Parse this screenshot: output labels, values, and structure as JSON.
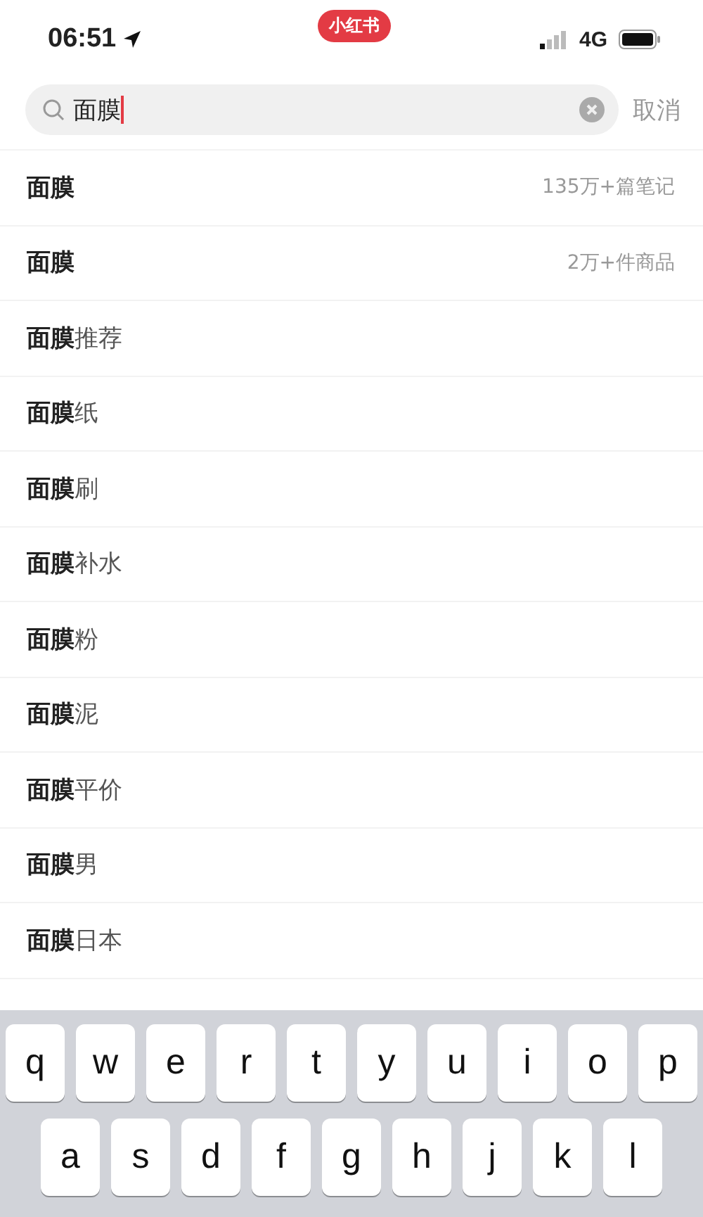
{
  "status_bar": {
    "time": "06:51",
    "app_badge": "小红书",
    "network": "4G"
  },
  "search": {
    "value": "面膜",
    "cancel": "取消"
  },
  "suggestions": [
    {
      "match": "面膜",
      "meta": "135万+篇笔记"
    },
    {
      "match": "面膜",
      "meta": "2万+件商品"
    },
    {
      "match": "面膜",
      "suffix": "推荐"
    },
    {
      "match": "面膜",
      "suffix": "纸"
    },
    {
      "match": "面膜",
      "suffix": "刷"
    },
    {
      "match": "面膜",
      "suffix": "补水"
    },
    {
      "match": "面膜",
      "suffix": "粉"
    },
    {
      "match": "面膜",
      "suffix": "泥"
    },
    {
      "match": "面膜",
      "suffix": "平价"
    },
    {
      "match": "面膜",
      "suffix": "男"
    },
    {
      "match": "面膜",
      "suffix": "日本"
    }
  ],
  "keyboard": {
    "rows": [
      [
        "q",
        "w",
        "e",
        "r",
        "t",
        "y",
        "u",
        "i",
        "o",
        "p"
      ],
      [
        "a",
        "s",
        "d",
        "f",
        "g",
        "h",
        "j",
        "k",
        "l"
      ]
    ]
  }
}
